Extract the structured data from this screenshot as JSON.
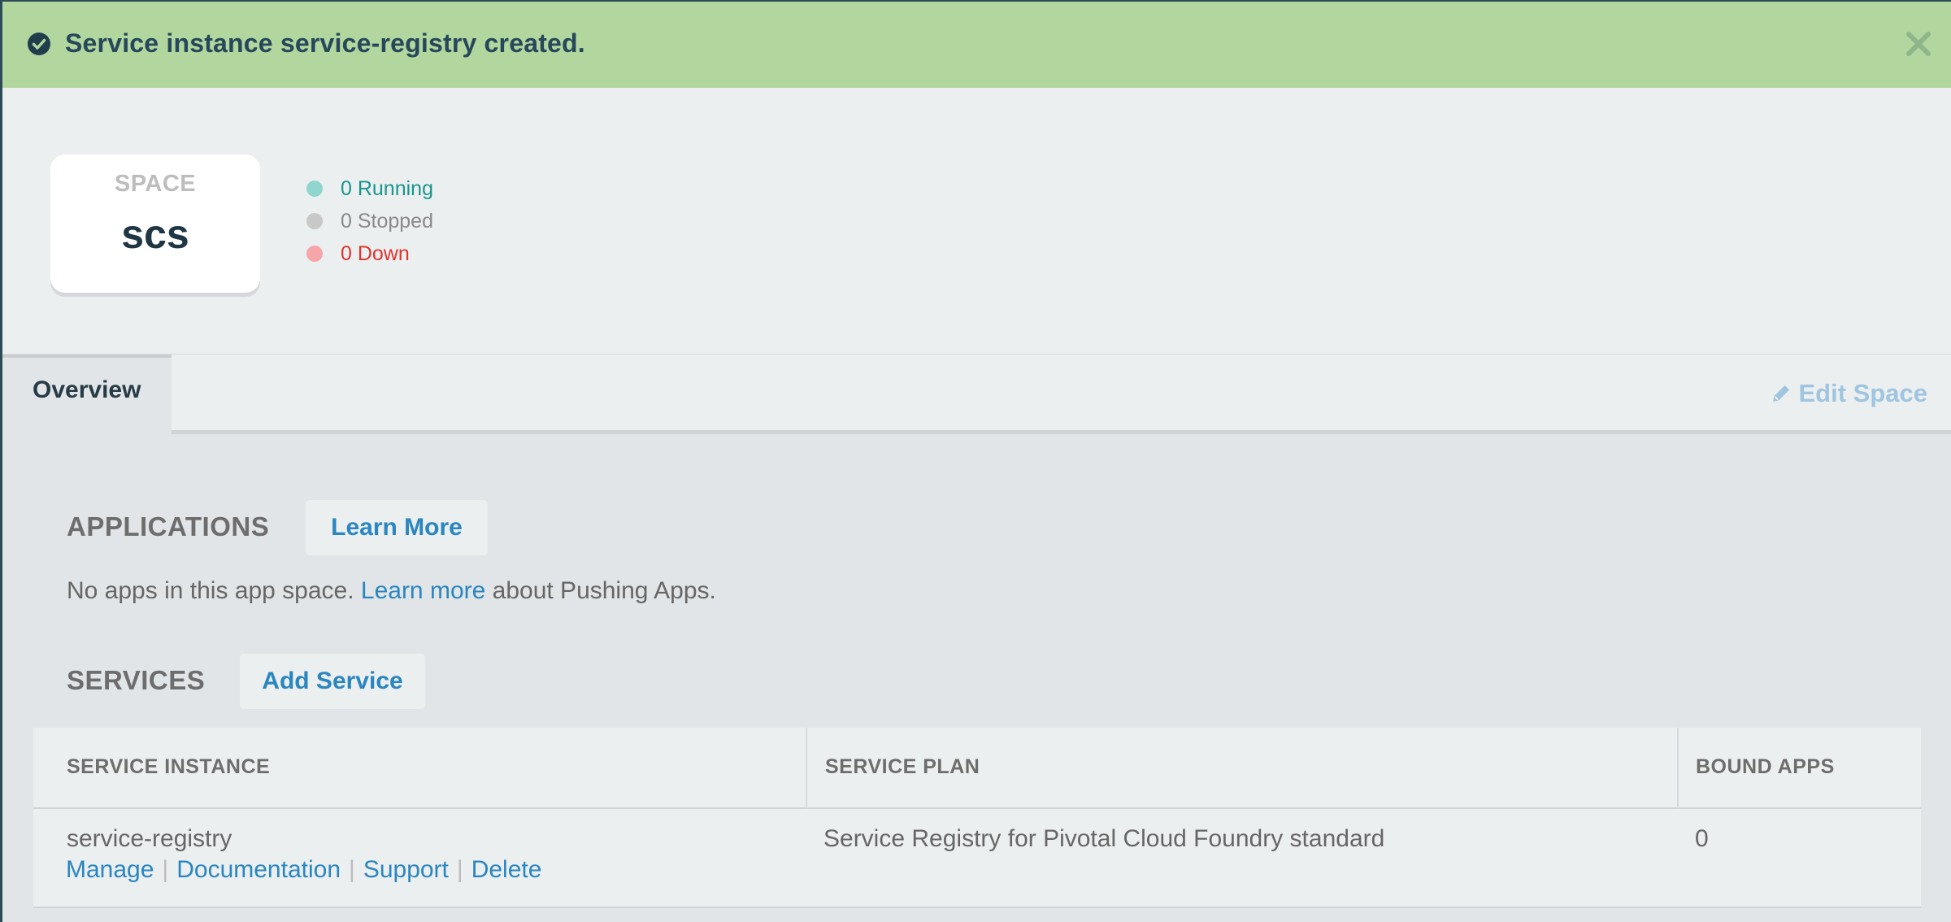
{
  "banner": {
    "message_prefix": "Service instance ",
    "message_name": "service-registry",
    "message_suffix": " created.",
    "icon": "check-circle-icon",
    "close_icon": "close-icon"
  },
  "space": {
    "label": "SPACE",
    "name": "scs"
  },
  "stats": {
    "running": "0 Running",
    "stopped": "0 Stopped",
    "down": "0 Down"
  },
  "tabs": {
    "overview": "Overview",
    "edit_space": "Edit Space"
  },
  "applications": {
    "title": "APPLICATIONS",
    "learn_more_button": "Learn More",
    "empty_prefix": "No apps in this app space. ",
    "empty_link": "Learn more",
    "empty_suffix": " about Pushing Apps."
  },
  "services": {
    "title": "SERVICES",
    "add_button": "Add Service",
    "columns": [
      "SERVICE INSTANCE",
      "SERVICE PLAN",
      "BOUND APPS"
    ],
    "rows": [
      {
        "instance": "service-registry",
        "plan": "Service Registry for Pivotal Cloud Foundry standard",
        "bound_apps": "0",
        "links": [
          "Manage",
          "Documentation",
          "Support",
          "Delete"
        ]
      }
    ]
  },
  "colors": {
    "banner_bg": "#b1d69e",
    "link": "#2a86c0",
    "running": "#18968c",
    "down": "#e0342f",
    "page_bg": "#e1e5e7"
  }
}
